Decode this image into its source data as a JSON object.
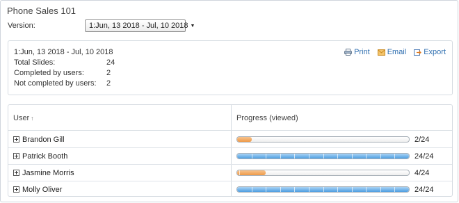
{
  "page": {
    "title": "Phone Sales 101"
  },
  "version": {
    "label": "Version:",
    "selected": "1:Jun, 13 2018 - Jul, 10 2018",
    "caret": "▼"
  },
  "summary": {
    "range": "1:Jun, 13 2018 - Jul, 10 2018",
    "rows": [
      {
        "label": "Total Slides:",
        "value": "24"
      },
      {
        "label": "Completed by users:",
        "value": "2"
      },
      {
        "label": "Not completed by users:",
        "value": "2"
      }
    ]
  },
  "actions": {
    "print": {
      "label": "Print",
      "icon": "printer-icon"
    },
    "email": {
      "label": "Email",
      "icon": "envelope-icon"
    },
    "export": {
      "label": "Export",
      "icon": "export-icon"
    }
  },
  "table": {
    "columns": {
      "user": "User",
      "sort_glyph": "↑",
      "progress": "Progress (viewed)"
    },
    "total_slides": 24,
    "rows": [
      {
        "name": "Brandon Gill",
        "viewed": 2,
        "count_text": "2/24",
        "color": "orange"
      },
      {
        "name": "Patrick Booth",
        "viewed": 24,
        "count_text": "24/24",
        "color": "blue"
      },
      {
        "name": "Jasmine Morris",
        "viewed": 4,
        "count_text": "4/24",
        "color": "orange"
      },
      {
        "name": "Molly Oliver",
        "viewed": 24,
        "count_text": "24/24",
        "color": "blue"
      }
    ]
  },
  "colors": {
    "link": "#2f6fb0",
    "progress_partial": "#ef9a48",
    "progress_complete": "#4f9ee0"
  }
}
